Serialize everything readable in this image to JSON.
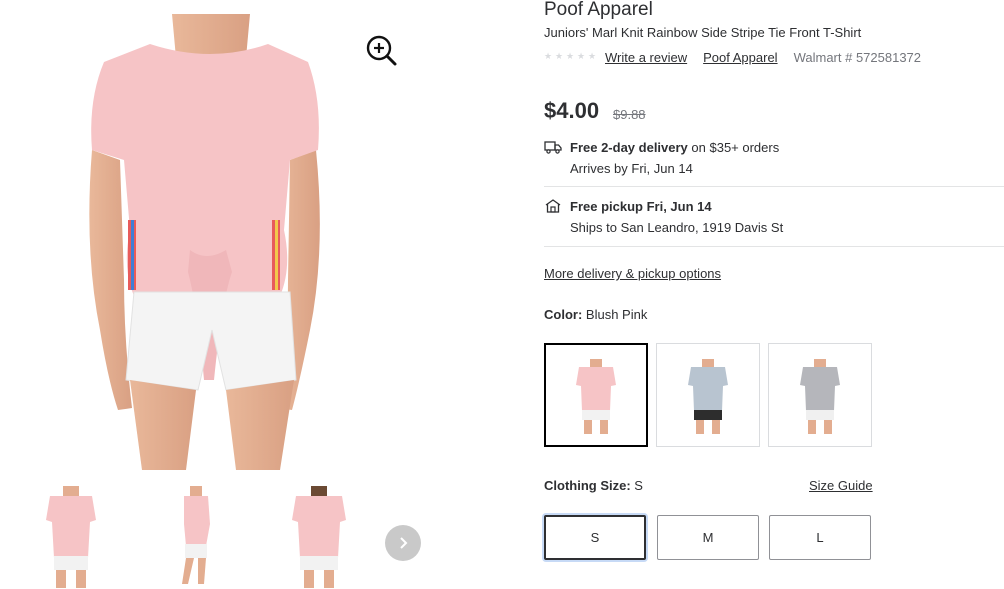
{
  "gallery": {
    "zoom_icon": "zoom-in-icon",
    "thumbnails": [
      "front",
      "side",
      "back"
    ],
    "next_icon": "chevron-right-icon"
  },
  "product": {
    "brand": "Poof Apparel",
    "title": "Juniors' Marl Knit Rainbow Side Stripe Tie Front T-Shirt",
    "rating": {
      "stars_filled": 0,
      "stars_total": 5
    },
    "write_review": "Write a review",
    "brand_link": "Poof Apparel",
    "walmart_number": "Walmart # 572581372",
    "price": "$4.00",
    "was_price": "$9.88"
  },
  "delivery": {
    "shipping": {
      "icon": "truck-icon",
      "bold": "Free 2-day delivery",
      "rest": " on $35+ orders",
      "arrives": "Arrives by Fri, Jun 14"
    },
    "pickup": {
      "icon": "store-icon",
      "bold": "Free pickup Fri, Jun 14",
      "location": "Ships to San Leandro, 1919 Davis St"
    },
    "more_options": "More delivery & pickup options"
  },
  "color": {
    "label": "Color:",
    "value": "Blush Pink",
    "swatches": [
      {
        "name": "Blush Pink",
        "shirt": "#f6c4c6",
        "bottom": "#f2f2f2",
        "selected": true
      },
      {
        "name": "Blue Grey",
        "shirt": "#b8c4d0",
        "bottom": "#2d2d2d",
        "selected": false
      },
      {
        "name": "Heather Grey",
        "shirt": "#b5b6bb",
        "bottom": "#f0f0f0",
        "selected": false
      }
    ]
  },
  "size": {
    "label": "Clothing Size:",
    "value": "S",
    "guide": "Size Guide",
    "options": [
      "S",
      "M",
      "L"
    ],
    "selected": "S"
  },
  "colors": {
    "text": "#2e2f32",
    "muted": "#74767c",
    "accent_ring": "#c7daf6",
    "shirt_pink": "#f6c4c6"
  }
}
